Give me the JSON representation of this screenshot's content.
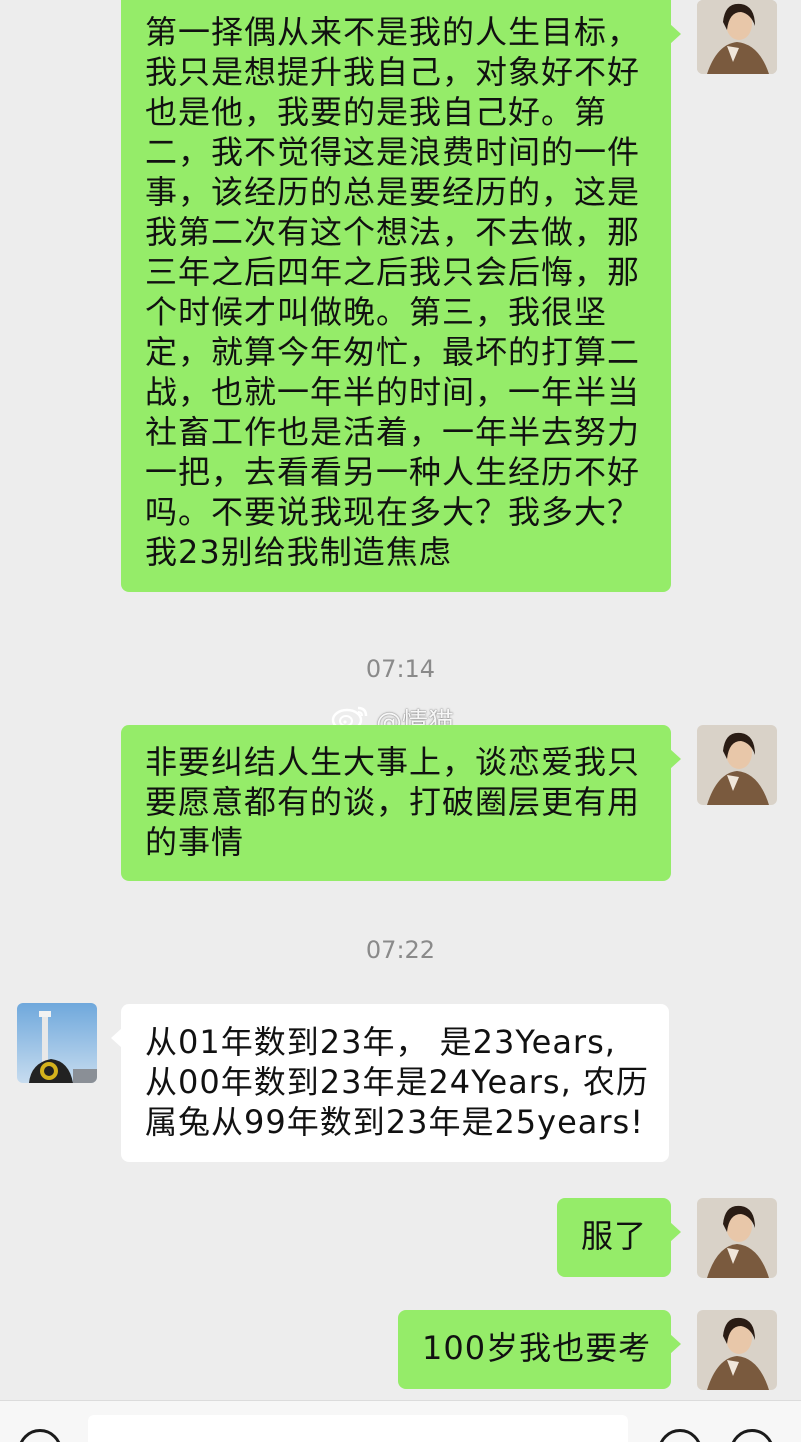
{
  "messages": [
    {
      "type": "sent",
      "text": "第一择偶从来不是我的人生目标，我只是想提升我自己，对象好不好也是他，我要的是我自己好。第二，我不觉得这是浪费时间的一件事，该经历的总是要经历的，这是我第二次有这个想法，不去做，那三年之后四年之后我只会后悔，那个时候才叫做晚。第三，我很坚定，就算今年匆忙，最坏的打算二战，也就一年半的时间，一年半当社畜工作也是活着，一年半去努力一把，去看看另一种人生经历不好吗。不要说我现在多大？我多大？我23别给我制造焦虑"
    },
    {
      "type": "time",
      "text": "07:14"
    },
    {
      "type": "sent",
      "text": "非要纠结人生大事上，谈恋爱我只要愿意都有的谈，打破圈层更有用的事情"
    },
    {
      "type": "time",
      "text": "07:22"
    },
    {
      "type": "recv",
      "text": "从01年数到23年， 是23Years, 从00年数到23年是24Years, 农历属兔从99年数到23年是25years!"
    },
    {
      "type": "sent",
      "text": "服了"
    },
    {
      "type": "sent",
      "text": "100岁我也要考"
    }
  ],
  "watermark": {
    "text": "@情猫",
    "icon": "weibo-icon"
  },
  "input_bar": {
    "icons": [
      "voice-icon",
      "emoji-icon",
      "plus-icon"
    ]
  },
  "colors": {
    "background": "#ededed",
    "sent_bubble": "#95ec69",
    "recv_bubble": "#ffffff",
    "time_text": "#8a8a8a"
  }
}
